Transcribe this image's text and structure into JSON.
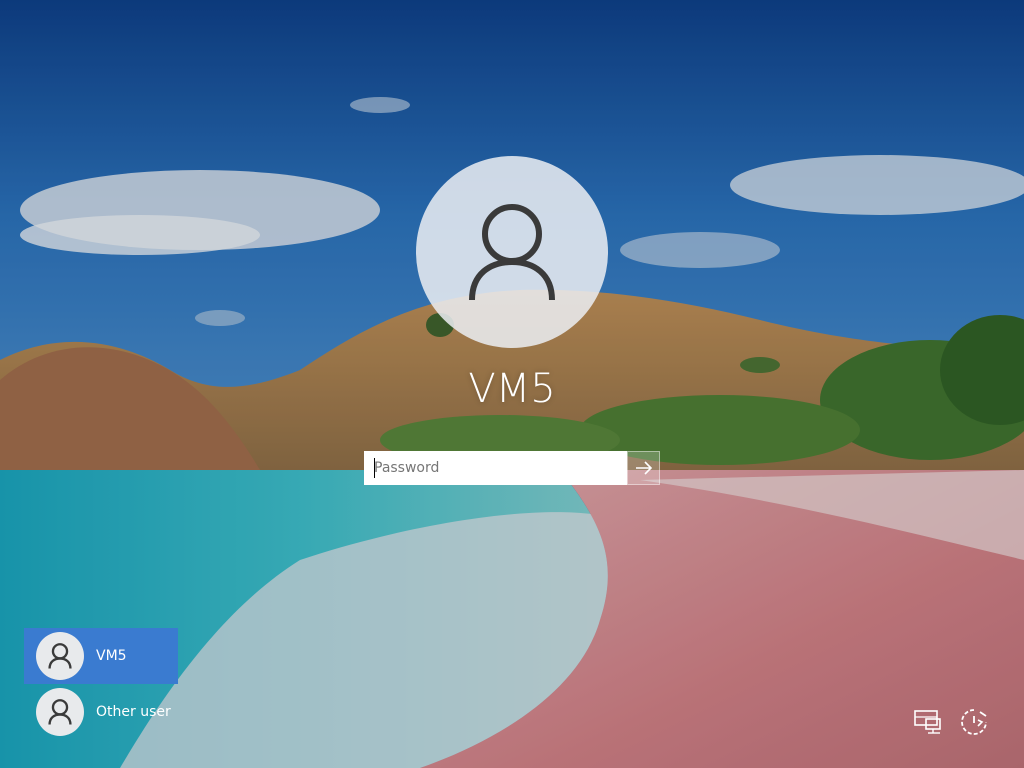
{
  "login": {
    "username": "VM5",
    "password_placeholder": "Password",
    "password_value": ""
  },
  "user_list": [
    {
      "label": "VM5",
      "selected": true
    },
    {
      "label": "Other user",
      "selected": false
    }
  ],
  "icons": {
    "avatar": "user-icon",
    "submit": "arrow-right-icon",
    "network": "network-icon",
    "power": "power-icon"
  },
  "colors": {
    "selected_tile": "#3a7bd0",
    "sky": "#1c4f96",
    "text": "#ffffff"
  }
}
